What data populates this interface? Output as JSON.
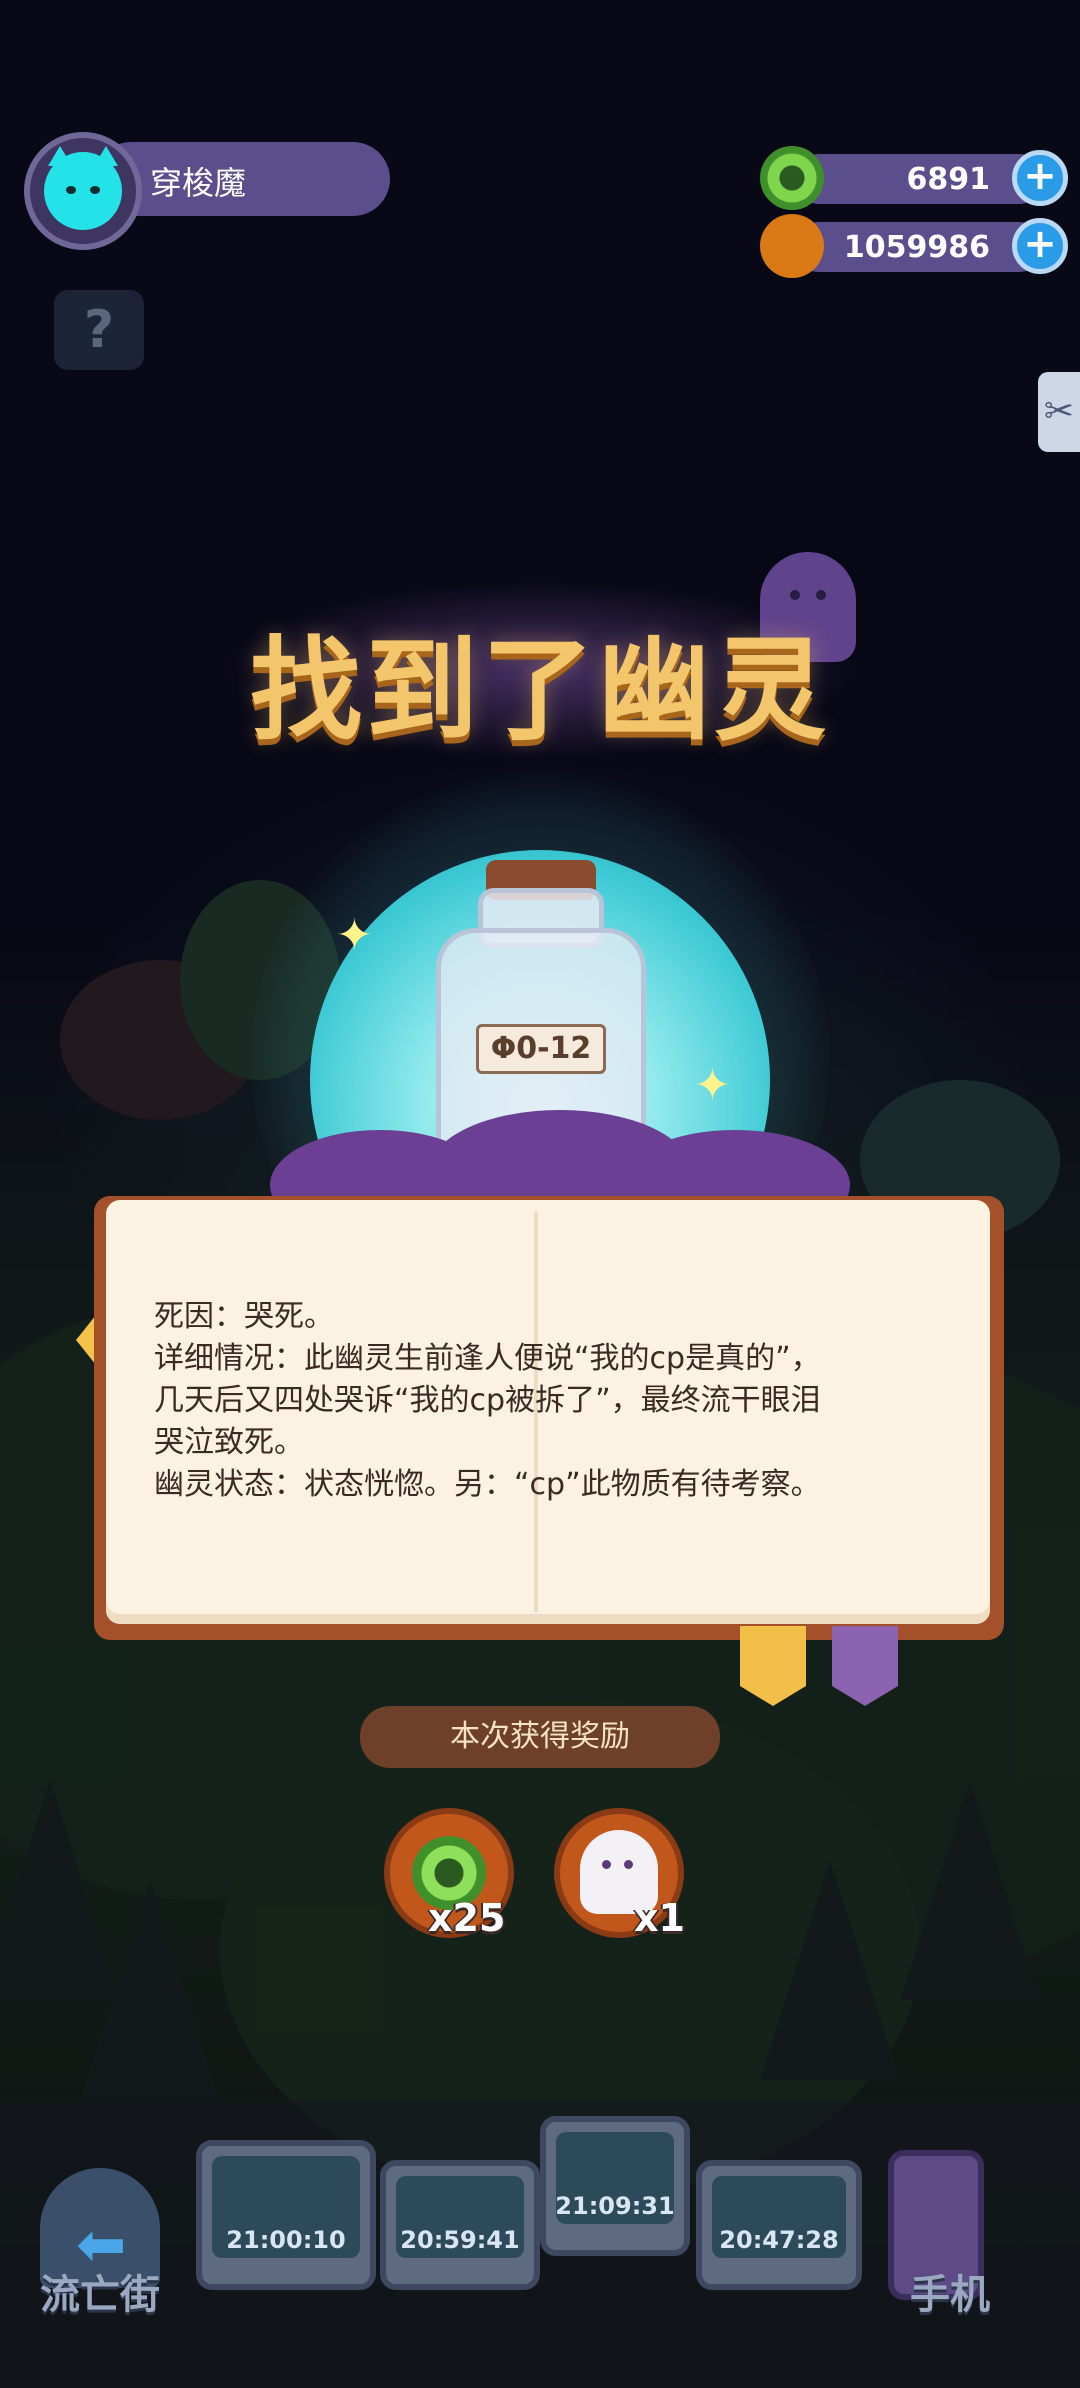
{
  "player": {
    "name": "穿梭魔"
  },
  "currencies": [
    {
      "name": "green-coin",
      "value": "6891",
      "color": "#7fd64c"
    },
    {
      "name": "gold-coin",
      "value": "1059986",
      "color": "#f7b62a"
    }
  ],
  "title": "找到了幽灵",
  "bottle_label": "Φ0-12",
  "description": {
    "line1": "死因：哭死。",
    "line2": "详细情况：此幽灵生前逢人便说“我的cp是真的”，",
    "line3": "几天后又四处哭诉“我的cp被拆了”，最终流干眼泪",
    "line4": "哭泣致死。",
    "line5": "幽灵状态：状态恍惚。另：“cp”此物质有待考察。"
  },
  "reward": {
    "banner": "本次获得奖励",
    "items": [
      {
        "icon": "green-coin-icon",
        "count": "x25"
      },
      {
        "icon": "ghost-icon",
        "count": "x1"
      }
    ]
  },
  "dock": {
    "left_label": "流亡街",
    "right_label": "手机",
    "timers": [
      "21:00:10",
      "20:59:41",
      "21:09:31",
      "20:47:28"
    ]
  },
  "colors": {
    "accent_purple": "#5a4f8c",
    "orb_cyan": "#3cc9d4",
    "title_gold": "#f3c66b"
  }
}
